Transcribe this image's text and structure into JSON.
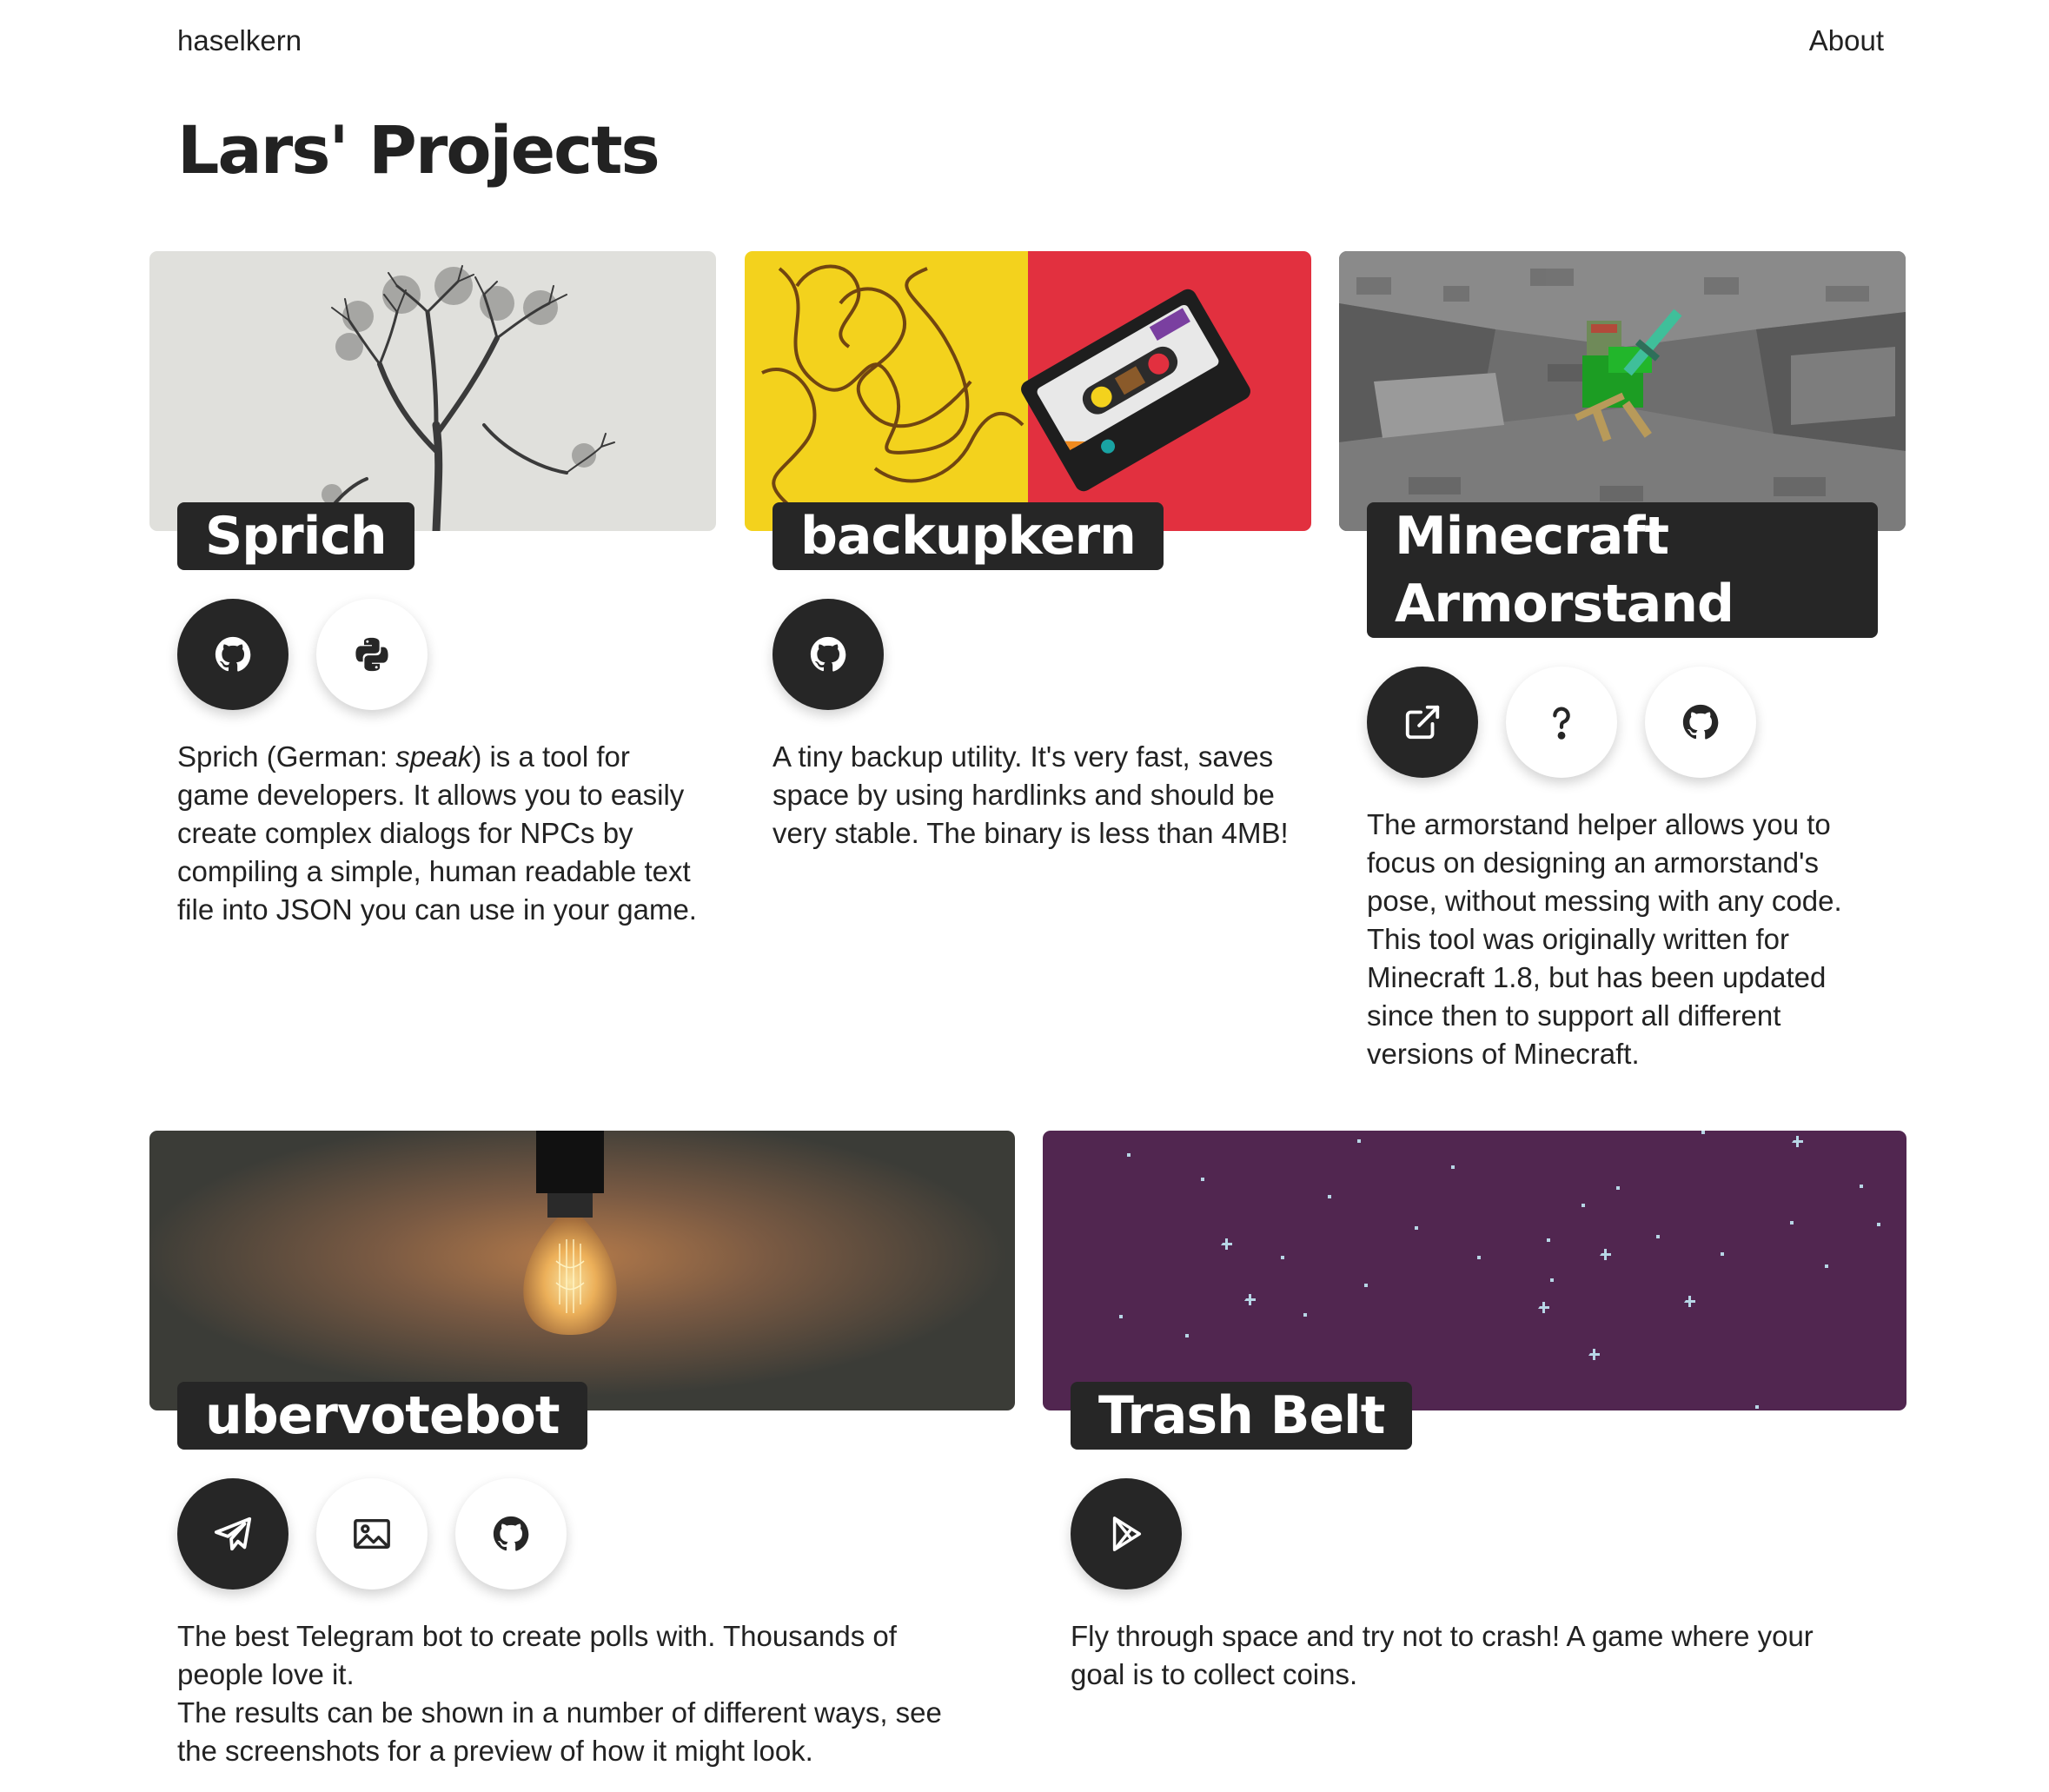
{
  "nav": {
    "brand": "haselkern",
    "about": "About"
  },
  "page": {
    "title": "Lars' Projects"
  },
  "projects": [
    {
      "title": "Sprich",
      "desc_a": "Sprich (German: ",
      "desc_em": "speak",
      "desc_b": ") is a tool for game developers. It allows you to easily create complex dialogs for NPCs by compiling a simple, human readable text file into JSON you can use in your game.",
      "buttons": [
        "github-icon",
        "python-icon"
      ]
    },
    {
      "title": "backupkern",
      "desc": "A tiny backup utility. It's very fast, saves space by using hardlinks and should be very stable. The binary is less than 4MB!",
      "buttons": [
        "github-icon"
      ]
    },
    {
      "title_line1": "Minecraft",
      "title_line2": "Armorstand",
      "desc": "The armorstand helper allows you to focus on designing an armorstand's pose, without messing with any code. This tool was originally written for Minecraft 1.8, but has been updated since then to support all different versions of Minecraft.",
      "buttons": [
        "external-link-icon",
        "question-icon",
        "github-icon"
      ]
    },
    {
      "title": "ubervotebot",
      "desc_line1": "The best Telegram bot to create polls with. Thousands of people love it.",
      "desc_line2": "The results can be shown in a number of different ways, see the screenshots for a preview of how it might look.",
      "buttons": [
        "telegram-icon",
        "image-icon",
        "github-icon"
      ]
    },
    {
      "title": "Trash Belt",
      "desc": "Fly through space and try not to crash! A game where your goal is to collect coins.",
      "buttons": [
        "play-store-icon"
      ]
    }
  ],
  "colors": {
    "dark": "#262626",
    "text": "#222222",
    "space": "#512650"
  }
}
